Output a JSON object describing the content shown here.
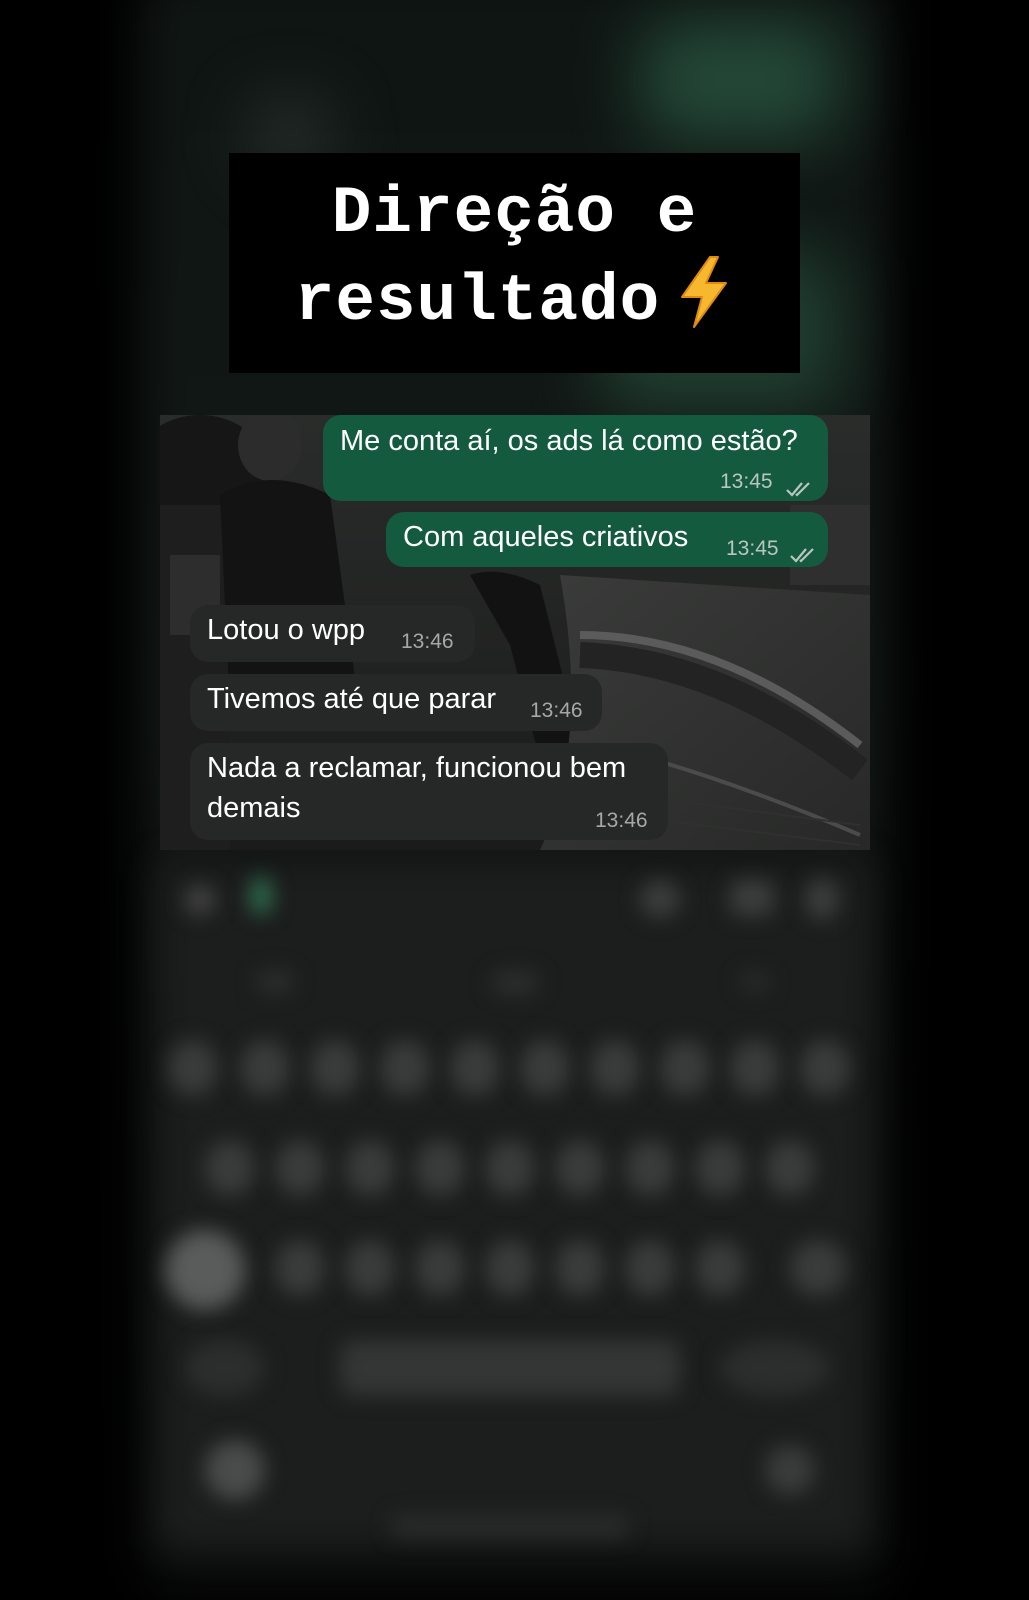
{
  "caption": {
    "line1": "Direção e",
    "line2": "resultado",
    "emoji_icon": "lightning-bolt-icon"
  },
  "chat": {
    "messages": [
      {
        "direction": "outgoing",
        "text": "Me conta aí, os ads lá como estão?",
        "time": "13:45",
        "status_icon": "double-check-icon"
      },
      {
        "direction": "outgoing",
        "text": "Com aqueles criativos",
        "time": "13:45",
        "status_icon": "double-check-icon"
      },
      {
        "direction": "incoming",
        "text": "Lotou o wpp",
        "time": "13:46"
      },
      {
        "direction": "incoming",
        "text": "Tivemos até que parar",
        "time": "13:46"
      },
      {
        "direction": "incoming",
        "text_line1": "Nada a reclamar, funcionou bem",
        "text_line2": "demais",
        "time": "13:46"
      }
    ]
  },
  "colors": {
    "outgoing_bubble": "#145a3f",
    "incoming_bubble": "#262827",
    "caption_background": "#000000",
    "lightning": "#f5b82e"
  }
}
